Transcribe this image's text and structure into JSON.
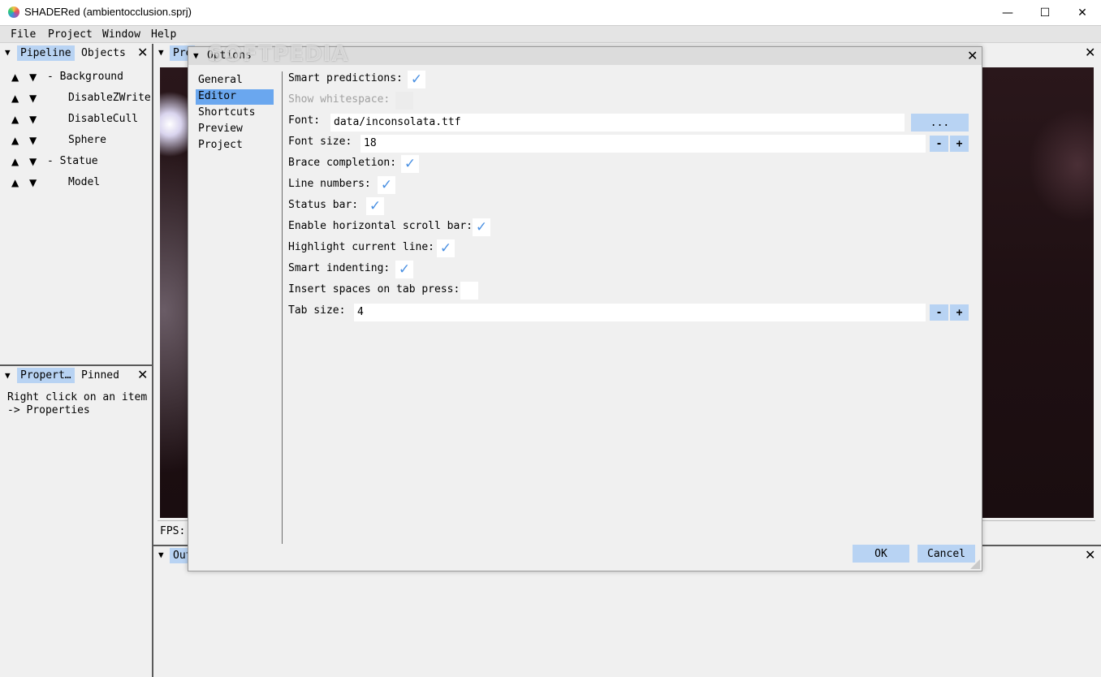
{
  "window": {
    "title": "SHADERed (ambientocclusion.sprj)",
    "minimize": "—",
    "maximize": "☐",
    "close": "✕"
  },
  "menubar": {
    "items": [
      "File",
      "Project",
      "Window",
      "Help"
    ]
  },
  "pipeline_panel": {
    "tabs": [
      "Pipeline",
      "Objects"
    ],
    "active_tab": "Pipeline",
    "items": [
      {
        "label": "- Background",
        "level": 0
      },
      {
        "label": "DisableZWrite",
        "level": 1
      },
      {
        "label": "DisableCull",
        "level": 1
      },
      {
        "label": "Sphere",
        "level": 1
      },
      {
        "label": "- Statue",
        "level": 0
      },
      {
        "label": "Model",
        "level": 1
      }
    ]
  },
  "properties_panel": {
    "tabs": [
      "Propert…",
      "Pinned"
    ],
    "active_tab": "Propert…",
    "message": "Right click on an item\n-> Properties"
  },
  "preview_panel": {
    "tab": "Pre",
    "fps_label": "FPS:"
  },
  "output_panel": {
    "tab": "Out"
  },
  "watermark": "SOFTPEDIA",
  "options_dialog": {
    "title": "Options",
    "categories": [
      "General",
      "Editor",
      "Shortcuts",
      "Preview",
      "Project"
    ],
    "active_category": "Editor",
    "settings": {
      "smart_predictions": {
        "label": "Smart predictions:",
        "checked": true
      },
      "show_whitespace": {
        "label": "Show whitespace:",
        "checked": false,
        "disabled": true
      },
      "font": {
        "label": "Font:",
        "value": "data/inconsolata.ttf",
        "browse": "..."
      },
      "font_size": {
        "label": "Font size:",
        "value": "18",
        "minus": "-",
        "plus": "+"
      },
      "brace_completion": {
        "label": "Brace completion:",
        "checked": true
      },
      "line_numbers": {
        "label": "Line numbers:",
        "checked": true
      },
      "status_bar": {
        "label": "Status bar:",
        "checked": true
      },
      "horizontal_scroll": {
        "label": "Enable horizontal scroll bar:",
        "checked": true
      },
      "highlight_line": {
        "label": "Highlight current line:",
        "checked": true
      },
      "smart_indenting": {
        "label": "Smart indenting:",
        "checked": true
      },
      "insert_spaces": {
        "label": "Insert spaces on tab press:",
        "checked": false
      },
      "tab_size": {
        "label": "Tab size:",
        "value": "4",
        "minus": "-",
        "plus": "+"
      }
    },
    "ok": "OK",
    "cancel": "Cancel",
    "checkmark_glyph": "✓",
    "accent_color": "#4a90e2"
  }
}
